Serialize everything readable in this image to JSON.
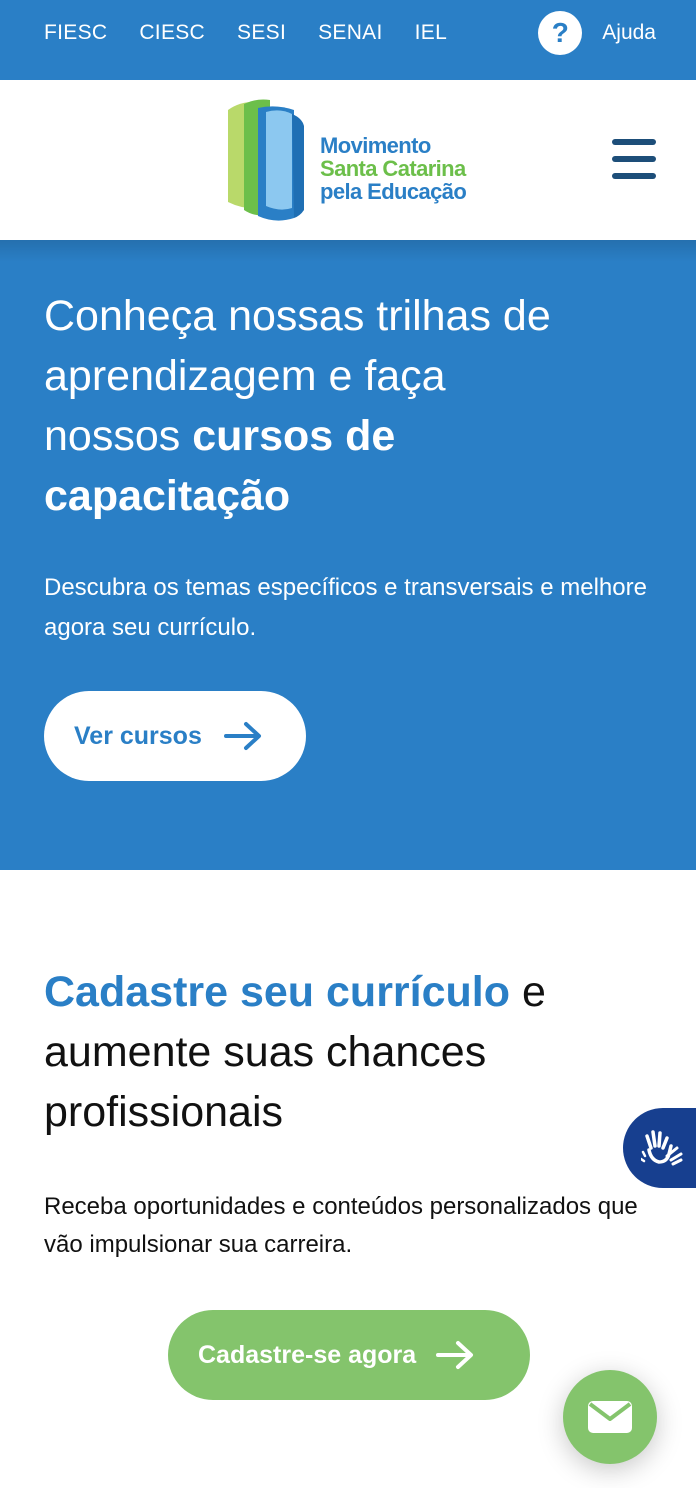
{
  "topbar": {
    "links": [
      "FIESC",
      "CIESC",
      "SESI",
      "SENAI",
      "IEL"
    ],
    "help_icon": "?",
    "help_label": "Ajuda"
  },
  "header": {
    "logo_line1": "Movimento",
    "logo_line2": "Santa Catarina",
    "logo_line3": "pela Educação",
    "menu_icon": "hamburger-menu-icon"
  },
  "hero": {
    "title_line1": "Conheça nossas trilhas de",
    "title_line2": "aprendizagem e faça",
    "title_line3_normal": "nossos ",
    "title_line3_bold": "cursos de",
    "title_line4_bold": "capacitação",
    "subtitle": "Descubra os temas específicos e transversais e melhore agora seu currículo.",
    "button_label": "Ver cursos",
    "button_icon": "arrow-right-icon"
  },
  "register": {
    "title_highlight": "Cadastre seu currículo",
    "title_rest_1": " e",
    "title_rest_2": "aumente suas chances",
    "title_rest_3": "profissionais",
    "text": "Receba oportunidades e conteúdos personalizados que vão impulsionar sua carreira.",
    "button_label": "Cadastre-se agora",
    "button_icon": "arrow-right-icon"
  },
  "widgets": {
    "accessibility_icon": "sign-language-hands-icon",
    "contact_icon": "envelope-icon"
  },
  "colors": {
    "brand_blue": "#2a7fc6",
    "brand_green": "#84c46c",
    "dark_navy": "#1d4e79",
    "a11y_blue": "#173f8f"
  }
}
